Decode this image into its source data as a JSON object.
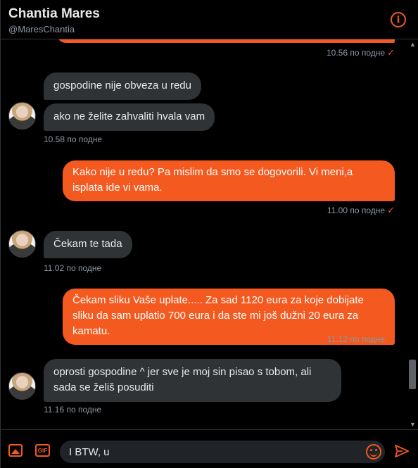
{
  "header": {
    "name": "Chantia Mares",
    "handle": "@MaresChantia",
    "info_icon": "info-icon"
  },
  "messages": [
    {
      "dir": "out",
      "text": "",
      "time": "10.56 по подне"
    },
    {
      "dir": "in",
      "text": "gospodine nije obveza u redu"
    },
    {
      "dir": "in",
      "text": "ako ne želite zahvaliti hvala vam",
      "time": "10.58 по подне"
    },
    {
      "dir": "out",
      "text": "Kako nije u redu? Pa mislim da smo se dogovorili. Vi meni,a isplata ide vi vama.",
      "time": "11.00 по подне"
    },
    {
      "dir": "in",
      "text": "Čekam te tada",
      "time": "11.02 по подне"
    },
    {
      "dir": "out",
      "text": "Čekam sliku Vaše uplate..... Za sad 1120 eura za koje dobijate sliku da sam uplatio 700 eura i da ste mi još dužni 20 eura za kamatu.",
      "time": "11.12 по подне"
    },
    {
      "dir": "in",
      "text": "oprosti gospodine ^ jer sve je moj sin pisao s tobom, ali sada se želiš posuditi",
      "time": "11.16 по подне"
    }
  ],
  "composer": {
    "value": "I BTW, u",
    "gif_label": "GIF",
    "icons": [
      "image-icon",
      "gif-icon",
      "emoji-icon",
      "send-icon"
    ]
  },
  "colors": {
    "accent": "#f4591f",
    "incoming_bubble": "#2f3336",
    "background": "#000000",
    "muted_text": "#8b98a5"
  }
}
